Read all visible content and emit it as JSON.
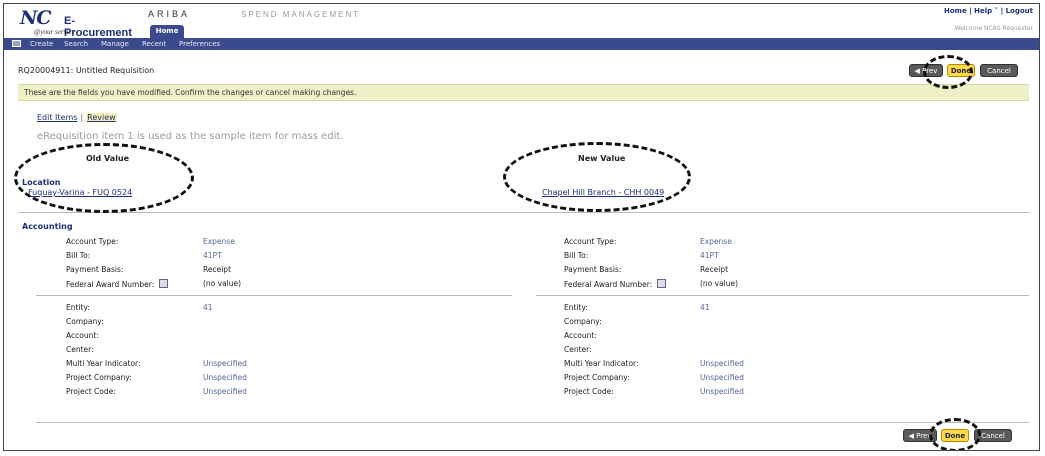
{
  "header": {
    "logo_main": "NC",
    "logo_sub": "E-Procurement",
    "logo_tagline": "@your service",
    "ariba": "ARIBA",
    "spend": "SPEND MANAGEMENT",
    "home_tab": "Home",
    "top_links": [
      "Home",
      "Help",
      "Logout"
    ],
    "welcome": "Welcome NCAS Requester"
  },
  "nav": {
    "items": [
      "Create",
      "Search",
      "Manage",
      "Recent",
      "Preferences"
    ]
  },
  "req": {
    "title": "RQ20004911: Untitled Requisition",
    "prev_label": "◀ Prev",
    "done_label": "Done",
    "cancel_label": "Cancel"
  },
  "notice": "These are the fields you have modified. Confirm the changes or cancel making changes.",
  "breadcrumb": {
    "edit_items": "Edit Items",
    "separator": "|",
    "review": "Review"
  },
  "sample_note": "eRequisition item 1 is used as the sample item for mass edit.",
  "columns": {
    "old": "Old Value",
    "new": "New Value"
  },
  "location": {
    "label": "Location",
    "old_value": "Fuquay-Varina - FUQ 0524",
    "new_value": "Chapel Hill Branch - CHH 0049"
  },
  "accounting": {
    "label": "Accounting",
    "group1": [
      {
        "label": "Account Type:",
        "value": "Expense",
        "tone": "color"
      },
      {
        "label": "Bill To:",
        "value": "41PT",
        "tone": "color"
      },
      {
        "label": "Payment Basis:",
        "value": "Receipt",
        "tone": "dark"
      },
      {
        "label": "Federal Award Number:",
        "value": "(no value)",
        "tone": "dark",
        "info": true
      }
    ],
    "group2": [
      {
        "label": "Entity:",
        "value": "41",
        "tone": "color"
      },
      {
        "label": "Company:",
        "value": "",
        "tone": "color"
      },
      {
        "label": "Account:",
        "value": "",
        "tone": "color"
      },
      {
        "label": "Center:",
        "value": "",
        "tone": "color"
      },
      {
        "label": "Multi Year Indicator:",
        "value": "Unspecified",
        "tone": "color"
      },
      {
        "label": "Project Company:",
        "value": "Unspecified",
        "tone": "color"
      },
      {
        "label": "Project Code:",
        "value": "Unspecified",
        "tone": "color"
      }
    ]
  },
  "colors": {
    "nav_bg": "#3b4a8c",
    "done_button": "#ffd84a",
    "notice_bg": "#eef0c8",
    "link": "#1d2f7a"
  }
}
